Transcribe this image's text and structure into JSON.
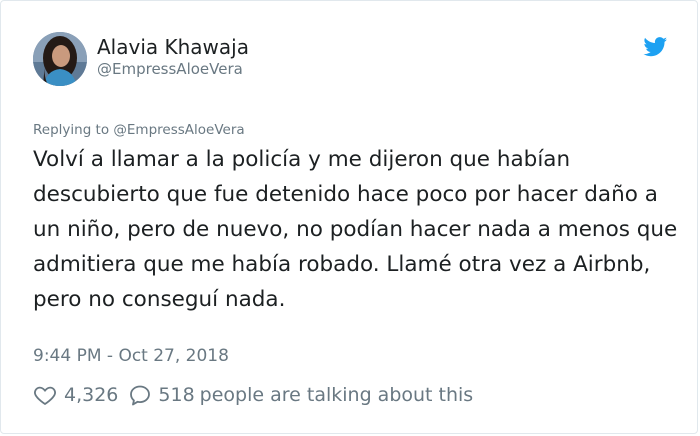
{
  "author": {
    "display_name": "Alavia Khawaja",
    "handle": "@EmpressAloeVera",
    "avatar_icon": "profile-photo"
  },
  "brand": {
    "icon": "twitter-bird-icon",
    "color": "#1da1f2"
  },
  "tweet": {
    "replying_to": "Replying to @EmpressAloeVera",
    "text": "Volví a llamar a la policía y me dijeron que habían descubierto que fue detenido hace poco por hacer daño a un niño, pero de nuevo, no podían hacer nada a menos que admitiera que me había robado. Llamé otra vez a Airbnb, pero no conseguí nada.",
    "timestamp": "9:44 PM - Oct 27, 2018"
  },
  "actions": {
    "like_icon": "heart-icon",
    "like_count": "4,326",
    "reply_icon": "speech-bubble-icon",
    "reply_count": "518",
    "talking_label": "people are talking about this"
  }
}
